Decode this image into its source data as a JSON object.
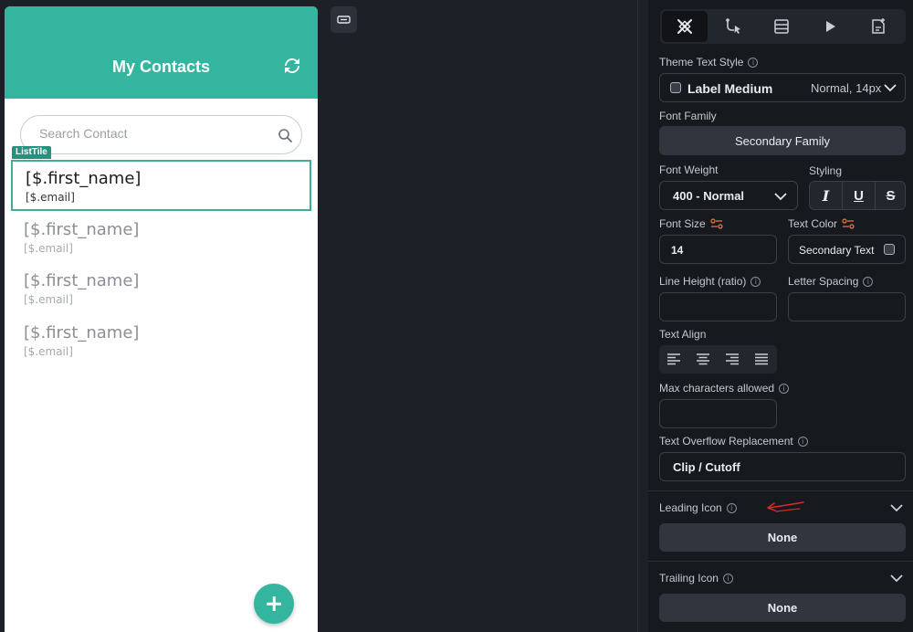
{
  "app": {
    "title": "My Contacts",
    "search_placeholder": "Search Contact",
    "tile_tag": "ListTile",
    "tiles": [
      {
        "name": "[$.first_name]",
        "email": "[$.email]"
      },
      {
        "name": "[$.first_name]",
        "email": "[$.email]"
      },
      {
        "name": "[$.first_name]",
        "email": "[$.email]"
      },
      {
        "name": "[$.first_name]",
        "email": "[$.email]"
      }
    ]
  },
  "panel": {
    "theme_text_style_label": "Theme Text Style",
    "theme_text_style_value": "Label Medium",
    "theme_text_style_detail": "Normal, 14px",
    "font_family_label": "Font Family",
    "font_family_value": "Secondary Family",
    "font_weight_label": "Font Weight",
    "font_weight_value": "400 - Normal",
    "styling_label": "Styling",
    "font_size_label": "Font Size",
    "font_size_value": "14",
    "text_color_label": "Text Color",
    "text_color_value": "Secondary Text",
    "line_height_label": "Line Height (ratio)",
    "letter_spacing_label": "Letter Spacing",
    "text_align_label": "Text Align",
    "max_chars_label": "Max characters allowed",
    "overflow_label": "Text Overflow Replacement",
    "overflow_value": "Clip / Cutoff",
    "leading_icon_label": "Leading Icon",
    "leading_icon_value": "None",
    "trailing_icon_label": "Trailing Icon",
    "trailing_icon_value": "None"
  },
  "colors": {
    "brand": "#33b59f",
    "panel_bg": "#16191e",
    "annotation": "#e0262a"
  }
}
